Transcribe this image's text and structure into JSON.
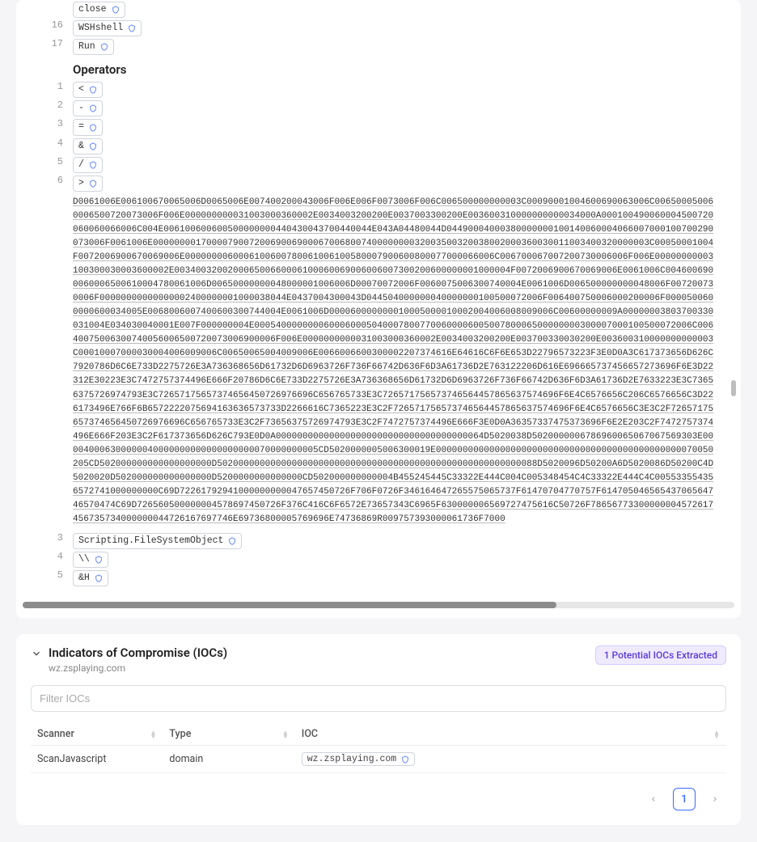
{
  "code": {
    "pre_lines": [
      {
        "num": "",
        "text": "close"
      },
      {
        "num": "16",
        "text": "WSHshell"
      },
      {
        "num": "17",
        "text": "Run"
      }
    ],
    "operators_title": "Operators",
    "op_lines": [
      {
        "num": "1",
        "text": "<"
      },
      {
        "num": "2",
        "text": "-"
      },
      {
        "num": "3",
        "text": "="
      },
      {
        "num": "4",
        "text": "&"
      },
      {
        "num": "5",
        "text": "/"
      },
      {
        "num": "6",
        "text": ">"
      }
    ],
    "hex_block": "D0061006E006100670065006D0065006E007400200043006F006E006F0073006F006C006500000000003C00090001004600690063006C006500050060006500720073006F006E000000000031003000360002E0034003200200E0037003300200E003600310000000000034000A000100490060004500720060060066006C004E006100600600500000000440430043700440044E043A04480044D04490004000380000000100140060004066007000100700290073006F0061006E000000001700007900720069006900067006800740000000032003500320038002000360030011003400320000003C00050001004F0072006900670069006E0000000060006100600780061006100580007900600800077000066006C006700067007200730006006F006E00000000003100300030003600002E003400320020006500660006100060069006006007300200600000001000004F0072006900670069006E0061006C0046006900060006500610004780061006D00650000000048000001006006D00070072006F0060075006300740004E0061006D006500000000048006F007200730006F00000000000000002400000001000038044E0437004300043D044504000000040000000100500072006F006400750006000200006F0000500600000600034005E0068006007400600300744004E0061006D000060000000010005000010002004006008009006C00600000009A00000003803700330031004E034030040001E007F000000004E0005400000000600060005040007800770060000600500780006500000000300007000100500072006C00640075006300740056006500720073006900006F006E0000000000031003000360002E0034003200200E003700330030200E003600310000000000003C00010007000030004006009006C00650065004009006E0066006600300002207374616E64616C6F6E653D22796573223F3E0D0A3C617373656D626C7920786D6C6E733D2275726E3A736368656D61732D6D6963726F736F66742D636F6D3A61736D2E763122206D616E696665737456657273696F6E3D22312E30223E3C7472757374496E666F20786D6C6E733D2275726E3A736368656D61732D6D6963726F736F66742D636F6D3A61736D2E7633223E3C73656375726974793E3C72657175657374656450726976696C656765733E3C726571756573746564457865637574696F6E4C6576656C206C6576656C3D226173496E766F6B6572222075694163636573733D2266616C7365223E3C2F726571756573746564457865637574696F6E4C6576656C3E3C2F72657175657374656450726976696C656765733E3C2F73656375726974793E3C2F7472757374496E666F3E0D0A36357337475373696F6E2E203C2F7472757374496E666F203E3C2F617373656D626C793E0D0A000000000000000000000000000000000000064D5020038D5020000006786960065067067569303E000040006300000040000000000000000000070000000005CD5020000005006300019E0000000000000000000000000000000000000000000000070050205CD502000000000000000000D502000000000000000000000000000000000000000000000000000000088D5020096D50200A6D5020086D50200C4D5020020D502000000000000000D5200000000000000CD502000000000004B455245445C33322E444C004C005348454C4C33322E444C4C005533554356572741000000000C69D72261792941000000000047657450726F706F0726F346164647265575065737F61470704770757F61470504656543706564746570474C69D726560500000004578697450726F376C416C6F6572E73657343C6965F630000006569727475616C50726F78656773300000004572617456735734000000044726167697746E69736800005769696E74736869R009757393000061736F7000",
    "post_lines": [
      {
        "num": "3",
        "text": "Scripting.FileSystemObject"
      },
      {
        "num": "4",
        "text": "\\\\"
      },
      {
        "num": "5",
        "text": "&H"
      }
    ]
  },
  "ioc": {
    "title": "Indicators of Compromise (IOCs)",
    "subtitle": "wz.zsplaying.com",
    "badge": "1 Potential IOCs Extracted",
    "filter_placeholder": "Filter IOCs",
    "columns": {
      "scanner": "Scanner",
      "type": "Type",
      "ioc": "IOC"
    },
    "row": {
      "scanner": "ScanJavascript",
      "type": "domain",
      "value": "wz.zsplaying.com"
    },
    "pager": {
      "current": "1"
    }
  }
}
